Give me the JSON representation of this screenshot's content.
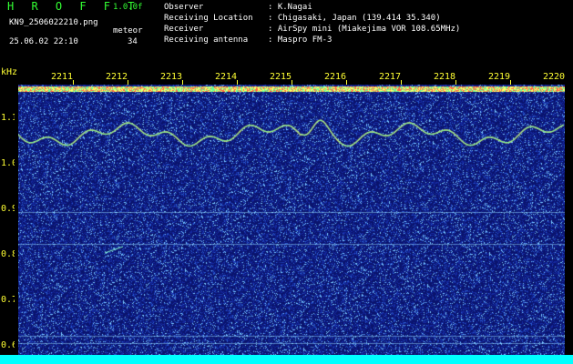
{
  "header": {
    "app_title": "H R O F F T",
    "version": "1.0.0f",
    "filename": "KN9_2506022210.png",
    "mode": "meteor",
    "datetime": "25.06.02 22:10",
    "count": "34",
    "info": [
      {
        "key": "Observer",
        "value": ": K.Nagai"
      },
      {
        "key": "Receiving Location",
        "value": ": Chigasaki, Japan (139.414 35.340)"
      },
      {
        "key": "Receiver",
        "value": ": AirSpy mini (Miakejima VOR 108.65MHz)"
      },
      {
        "key": "Receiving antenna",
        "value": ": Maspro FM-3"
      }
    ]
  },
  "axes": {
    "y_unit": "kHz",
    "y_ticks": [
      "1.1",
      "1.0",
      "0.9",
      "0.8",
      "0.7",
      "0.6"
    ],
    "time_ticks": [
      "2211",
      "2212",
      "2213",
      "2214",
      "2215",
      "2216",
      "2217",
      "2218",
      "2219",
      "2220"
    ]
  },
  "colors": {
    "background": "#0a1260",
    "label": "#ffff33",
    "title": "#33ff33",
    "bottom_bar": "#00ffff"
  }
}
